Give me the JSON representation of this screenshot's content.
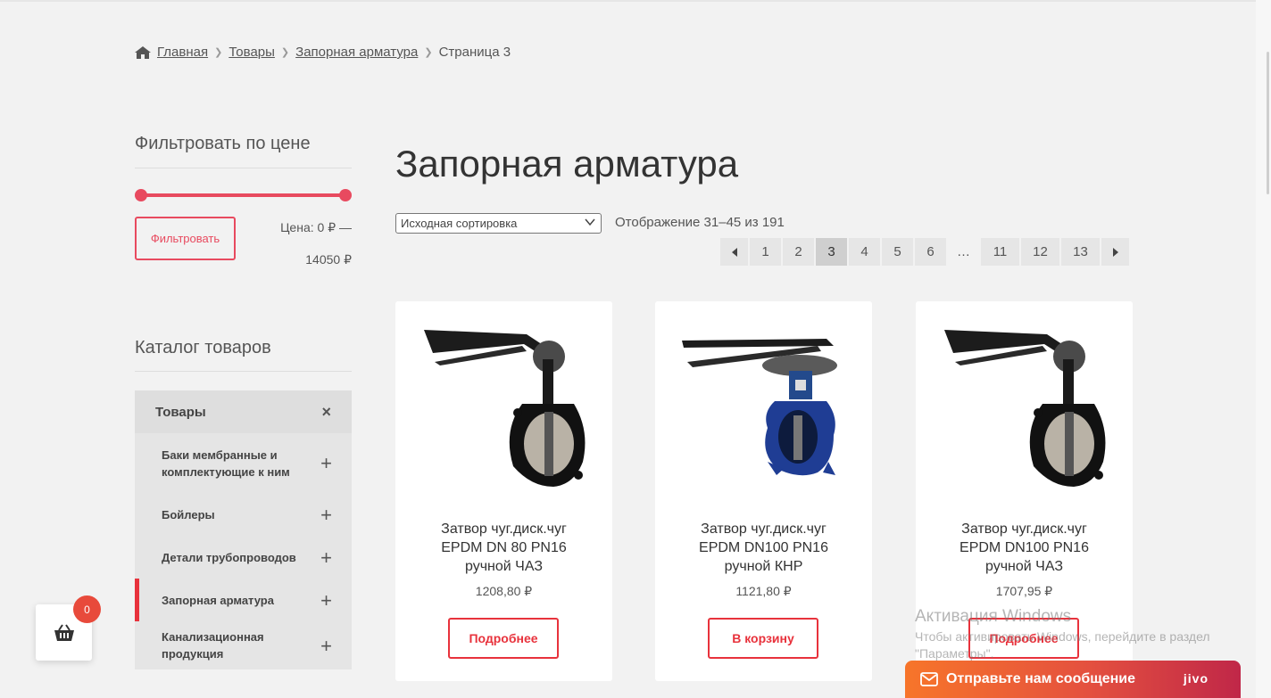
{
  "breadcrumb": {
    "home": "Главная",
    "goods": "Товары",
    "category": "Запорная арматура",
    "current": "Страница 3"
  },
  "sidebar": {
    "price_filter_title": "Фильтровать по цене",
    "filter_button": "Фильтровать",
    "price_label_line1": "Цена: 0 ₽ —",
    "price_label_line2": "14050 ₽",
    "catalog_title": "Каталог товаров",
    "catalog_head": "Товары",
    "catalog_close": "×",
    "items": [
      {
        "label_1": "Баки мембранные и",
        "label_2": "комплектующие к ним",
        "expand": "+"
      },
      {
        "label_1": "Бойлеры",
        "expand": "+"
      },
      {
        "label_1": "Детали трубопроводов",
        "expand": "+"
      },
      {
        "label_1": "Запорная арматура",
        "expand": "+"
      },
      {
        "label_1": "Канализационная",
        "label_2": "продукция",
        "expand": "+"
      }
    ]
  },
  "main": {
    "title": "Запорная арматура",
    "sort_selected": "Исходная сортировка",
    "result_count": "Отображение 31–45 из 191",
    "pages": [
      "1",
      "2",
      "3",
      "4",
      "5",
      "6",
      "…",
      "11",
      "12",
      "13"
    ],
    "current_page": "3"
  },
  "products": [
    {
      "name_1": "Затвор чуг.диск.чуг",
      "name_2": "EPDM DN 80 PN16",
      "name_3": "ручной ЧАЗ",
      "price": "1208,80 ₽",
      "cta": "Подробнее"
    },
    {
      "name_1": "Затвор чуг.диск.чуг",
      "name_2": "EPDM DN100 PN16",
      "name_3": "ручной КНР",
      "price": "1121,80 ₽",
      "cta": "В корзину"
    },
    {
      "name_1": "Затвор чуг.диск.чуг",
      "name_2": "EPDM DN100 PN16",
      "name_3": "ручной ЧАЗ",
      "price": "1707,95 ₽",
      "cta": "Подробнее"
    }
  ],
  "cart": {
    "count": "0"
  },
  "watermark": {
    "line1": "Активация Windows",
    "line2": "Чтобы активировать Windows, перейдите в раздел",
    "line3": "\"Параметры\"."
  },
  "jivo": {
    "label": "Отправьте нам сообщение",
    "brand": "jivo"
  },
  "colors": {
    "accent": "#e84a5f",
    "cta": "#e8323c",
    "jivo_start": "#f7752a",
    "jivo_end": "#c02748"
  }
}
